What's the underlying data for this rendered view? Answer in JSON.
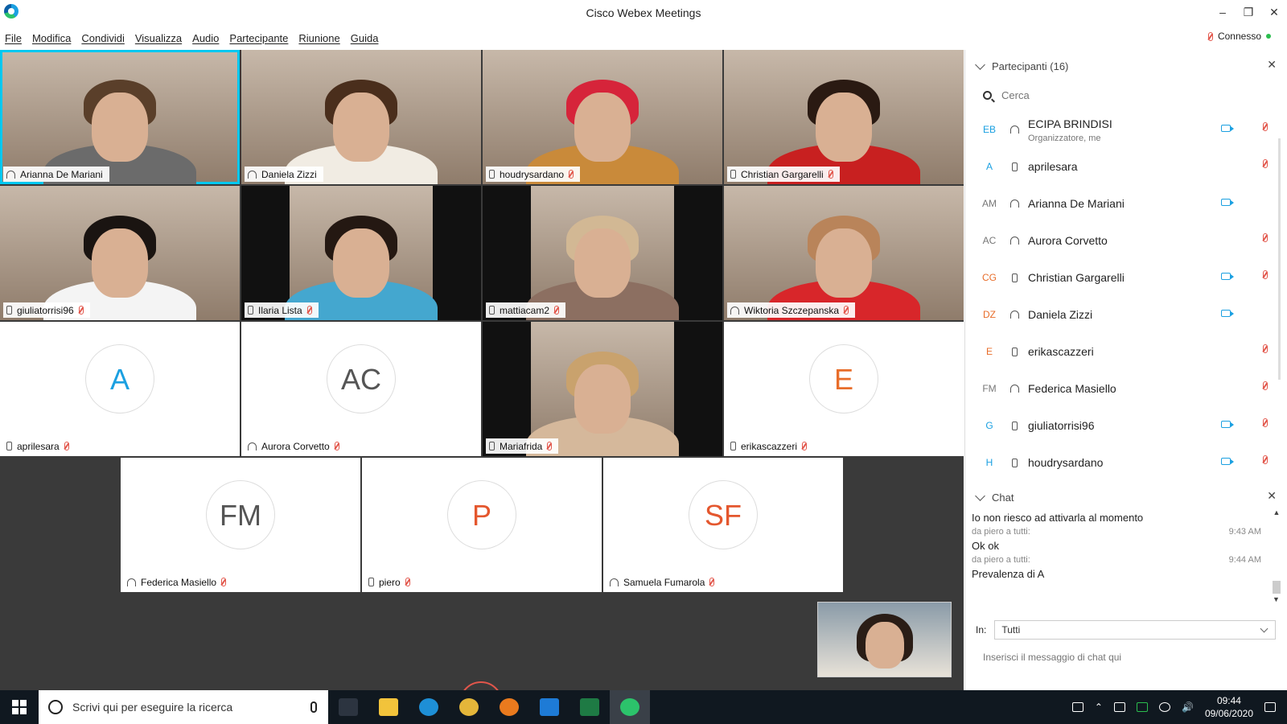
{
  "window": {
    "title": "Cisco Webex Meetings",
    "minimize": "–",
    "restore": "❐",
    "close": "✕"
  },
  "menu": [
    "File",
    "Modifica",
    "Condividi",
    "Visualizza",
    "Audio",
    "Partecipante",
    "Riunione",
    "Guida"
  ],
  "status": {
    "connection": "Connesso"
  },
  "tiles": [
    {
      "name": "Arianna De Mariani",
      "kind": "video",
      "device": "headset",
      "muted": false,
      "active": true,
      "hair": "#5a3f2a",
      "shirt": "#6b6b6b"
    },
    {
      "name": "Daniela Zizzi",
      "kind": "video",
      "device": "headset",
      "muted": false,
      "hair": "#4a2e1c",
      "shirt": "#f1ece3"
    },
    {
      "name": "houdrysardano",
      "kind": "video",
      "device": "phone",
      "muted": true,
      "hair": "#d6243a",
      "shirt": "#c98a3a"
    },
    {
      "name": "Christian Gargarelli",
      "kind": "video",
      "device": "phone",
      "muted": true,
      "hair": "#2a1a12",
      "shirt": "#c82020"
    },
    {
      "name": "giuliatorrisi96",
      "kind": "video",
      "device": "phone",
      "muted": true,
      "hair": "#1a1411",
      "shirt": "#f4f4f4"
    },
    {
      "name": "Ilaria Lista",
      "kind": "video",
      "device": "phone",
      "muted": true,
      "bars": true,
      "hair": "#241812",
      "shirt": "#44a7cf"
    },
    {
      "name": "mattiacam2",
      "kind": "video",
      "device": "phone",
      "muted": true,
      "bars": true,
      "hair": "#d2b894",
      "shirt": "#8c6f61"
    },
    {
      "name": "Wiktoria Szczepanska",
      "kind": "video",
      "device": "headset",
      "muted": true,
      "hair": "#b9845a",
      "shirt": "#d8262a"
    },
    {
      "name": "aprilesara",
      "kind": "avatar",
      "initials": "A",
      "color": "blue",
      "device": "phone",
      "muted": true
    },
    {
      "name": "Aurora Corvetto",
      "kind": "avatar",
      "initials": "AC",
      "color": "gray",
      "device": "headset",
      "muted": true
    },
    {
      "name": "Mariafrida",
      "kind": "video",
      "device": "phone",
      "muted": true,
      "bars": true,
      "hair": "#c9a26d",
      "shirt": "#d5b89b"
    },
    {
      "name": "erikascazzeri",
      "kind": "avatar",
      "initials": "E",
      "color": "orange",
      "device": "phone",
      "muted": true
    },
    {
      "name": "Federica Masiello",
      "kind": "avatar",
      "initials": "FM",
      "color": "gray",
      "device": "headset",
      "muted": true
    },
    {
      "name": "piero",
      "kind": "avatar",
      "initials": "P",
      "color": "red",
      "device": "phone",
      "muted": true
    },
    {
      "name": "Samuela Fumarola",
      "kind": "avatar",
      "initials": "SF",
      "color": "red",
      "device": "headset",
      "muted": true
    }
  ],
  "participants": {
    "title": "Partecipanti (16)",
    "search_placeholder": "Cerca",
    "items": [
      {
        "initials": "EB",
        "name": "ECIPA BRINDISI",
        "subtitle": "Organizzatore, me",
        "device": "headset",
        "video": true,
        "muted": true,
        "color": "#1ba0e1"
      },
      {
        "initials": "A",
        "name": "aprilesara",
        "device": "phone",
        "video": false,
        "muted": true,
        "color": "#1ba0e1"
      },
      {
        "initials": "AM",
        "name": "Arianna De Mariani",
        "device": "headset",
        "video": true,
        "muted": false,
        "color": "#777777"
      },
      {
        "initials": "AC",
        "name": "Aurora Corvetto",
        "device": "headset",
        "video": false,
        "muted": true,
        "color": "#777777"
      },
      {
        "initials": "CG",
        "name": "Christian Gargarelli",
        "device": "phone",
        "video": true,
        "muted": true,
        "color": "#e86d2a"
      },
      {
        "initials": "DZ",
        "name": "Daniela Zizzi",
        "device": "headset",
        "video": true,
        "muted": false,
        "color": "#e86d2a"
      },
      {
        "initials": "E",
        "name": "erikascazzeri",
        "device": "phone",
        "video": false,
        "muted": true,
        "color": "#e86d2a"
      },
      {
        "initials": "FM",
        "name": "Federica Masiello",
        "device": "headset",
        "video": false,
        "muted": true,
        "color": "#777777"
      },
      {
        "initials": "G",
        "name": "giuliatorrisi96",
        "device": "phone",
        "video": true,
        "muted": true,
        "color": "#1ba0e1"
      },
      {
        "initials": "H",
        "name": "houdrysardano",
        "device": "phone",
        "video": true,
        "muted": true,
        "color": "#1ba0e1"
      }
    ]
  },
  "chat": {
    "title": "Chat",
    "messages": [
      {
        "text": "Io non riesco ad attivarla al momento"
      },
      {
        "from": "da piero a tutti:",
        "time": "9:43 AM",
        "text": "Ok ok"
      },
      {
        "from": "da piero a tutti:",
        "time": "9:44 AM",
        "text": "Prevalenza di A"
      }
    ],
    "to_label": "In:",
    "to_value": "Tutti",
    "input_placeholder": "Inserisci il messaggio di chat qui"
  },
  "taskbar": {
    "search_placeholder": "Scrivi qui per eseguire la ricerca",
    "apps": [
      {
        "name": "task-view",
        "color": "#2c3440"
      },
      {
        "name": "file-explorer",
        "color": "#f2c33b"
      },
      {
        "name": "edge",
        "color": "#1e8fd6"
      },
      {
        "name": "chrome",
        "color": "#e4b63a"
      },
      {
        "name": "firefox",
        "color": "#ea7a1e"
      },
      {
        "name": "mail",
        "color": "#1e7bd6"
      },
      {
        "name": "excel",
        "color": "#1e7a44"
      },
      {
        "name": "webex",
        "color": "#2cc36b"
      }
    ],
    "time": "09:44",
    "date": "09/06/2020"
  }
}
